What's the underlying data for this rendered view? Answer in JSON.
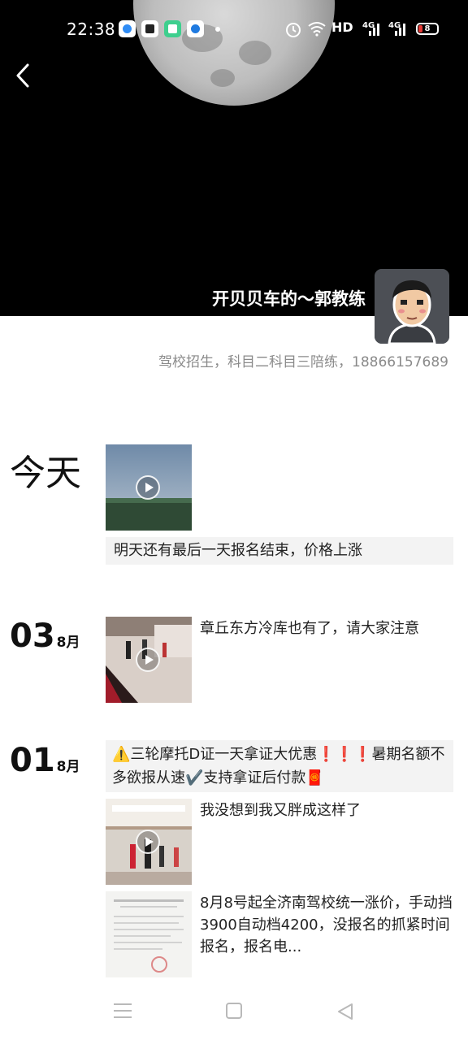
{
  "status_bar": {
    "time": "22:38",
    "hd_label": "HD",
    "net1": "4G",
    "net2": "4G",
    "battery": "8"
  },
  "profile": {
    "name": "开贝贝车的～郭教练",
    "signature": "驾校招生，科目二科目三陪练，18866157689"
  },
  "timeline": {
    "today": {
      "label": "今天",
      "caption": "明天还有最后一天报名结束，价格上涨"
    },
    "day2": {
      "day": "03",
      "month": "8月",
      "text": "章丘东方冷库也有了，请大家注意"
    },
    "day3": {
      "day": "01",
      "month": "8月",
      "promo": "⚠️三轮摩托D证一天拿证大优惠❗❗❗暑期名额不多欲报从速✔️支持拿证后付款🧧",
      "post1_text": "我没想到我又胖成这样了",
      "post2_text": "8月8号起全济南驾校统一涨价，手动挡3900自动档4200，没报名的抓紧时间报名，报名电..."
    }
  },
  "colors": {
    "cover_bg": "#000000",
    "signature_text": "#8a8a8a",
    "text_box_bg": "#f3f3f3"
  }
}
